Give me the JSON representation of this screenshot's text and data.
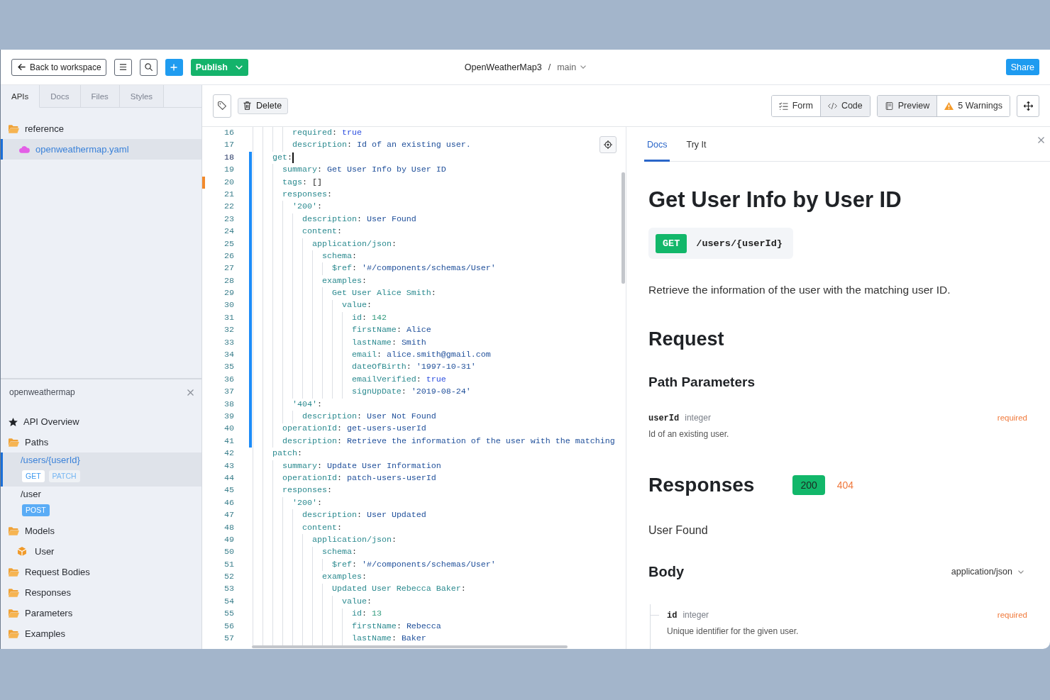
{
  "top_bar": {
    "back_button": "Back to workspace",
    "publish_button": "Publish",
    "project": "OpenWeatherMap3",
    "separator": "/",
    "branch": "main",
    "share_button": "Share"
  },
  "sidebar": {
    "tabs": [
      {
        "label": "APIs",
        "selected": true
      },
      {
        "label": "Docs",
        "selected": false
      },
      {
        "label": "Files",
        "selected": false
      },
      {
        "label": "Styles",
        "selected": false
      }
    ],
    "files": [
      {
        "label": "reference",
        "kind": "folder",
        "selected": false,
        "children": [
          {
            "label": "openweathermap.yaml",
            "kind": "api",
            "selected": true
          }
        ]
      }
    ],
    "outline": {
      "title": "openweathermap",
      "items": [
        {
          "label": "API Overview",
          "kind": "overview",
          "selected": false
        },
        {
          "label": "Paths",
          "kind": "folder",
          "selected": false,
          "children": [
            {
              "label": "/users/{userId}",
              "kind": "path",
              "selected": true,
              "methods": [
                {
                  "label": "GET",
                  "selected": true
                },
                {
                  "label": "PATCH",
                  "selected": false
                }
              ]
            },
            {
              "label": "/user",
              "kind": "path",
              "selected": false,
              "methods": [
                {
                  "label": "POST",
                  "selected": false
                }
              ]
            }
          ]
        },
        {
          "label": "Models",
          "kind": "folder",
          "selected": false,
          "children": [
            {
              "label": "User",
              "kind": "model",
              "selected": false
            }
          ]
        },
        {
          "label": "Request Bodies",
          "kind": "folder",
          "selected": false
        },
        {
          "label": "Responses",
          "kind": "folder",
          "selected": false
        },
        {
          "label": "Parameters",
          "kind": "folder",
          "selected": false
        },
        {
          "label": "Examples",
          "kind": "folder",
          "selected": false
        }
      ]
    }
  },
  "toolbar": {
    "delete_button": "Delete",
    "modes": [
      {
        "label": "Form",
        "selected": false
      },
      {
        "label": "Code",
        "selected": true
      }
    ],
    "preview_toggle": {
      "label": "Preview",
      "selected": true
    },
    "warnings_button": "5 Warnings"
  },
  "editor": {
    "lines": [
      {
        "number": "16",
        "active": false,
        "changed": false,
        "warning": false,
        "tokens": [
          {
            "kind": "key",
            "text": "        required"
          },
          {
            "kind": "punct",
            "text": ": "
          },
          {
            "kind": "boolean",
            "text": "true"
          }
        ]
      },
      {
        "number": "17",
        "active": false,
        "changed": false,
        "warning": false,
        "tokens": [
          {
            "kind": "key",
            "text": "        description"
          },
          {
            "kind": "punct",
            "text": ": "
          },
          {
            "kind": "string",
            "text": "Id of an existing user."
          }
        ]
      },
      {
        "number": "18",
        "active": true,
        "changed": true,
        "warning": false,
        "tokens": [
          {
            "kind": "key",
            "text": "    get"
          },
          {
            "kind": "punct",
            "text": ":"
          }
        ]
      },
      {
        "number": "19",
        "active": false,
        "changed": true,
        "warning": false,
        "tokens": [
          {
            "kind": "key",
            "text": "      summary"
          },
          {
            "kind": "punct",
            "text": ": "
          },
          {
            "kind": "string",
            "text": "Get User Info by User ID"
          }
        ]
      },
      {
        "number": "20",
        "active": false,
        "changed": true,
        "warning": true,
        "tokens": [
          {
            "kind": "key",
            "text": "      tags"
          },
          {
            "kind": "punct",
            "text": ": "
          },
          {
            "kind": "plain",
            "text": "[]"
          }
        ]
      },
      {
        "number": "21",
        "active": false,
        "changed": true,
        "warning": false,
        "tokens": [
          {
            "kind": "key",
            "text": "      responses"
          },
          {
            "kind": "punct",
            "text": ":"
          }
        ]
      },
      {
        "number": "22",
        "active": false,
        "changed": true,
        "warning": false,
        "tokens": [
          {
            "kind": "key",
            "text": "        '200'"
          },
          {
            "kind": "punct",
            "text": ":"
          }
        ]
      },
      {
        "number": "23",
        "active": false,
        "changed": true,
        "warning": false,
        "tokens": [
          {
            "kind": "key",
            "text": "          description"
          },
          {
            "kind": "punct",
            "text": ": "
          },
          {
            "kind": "string",
            "text": "User Found"
          }
        ]
      },
      {
        "number": "24",
        "active": false,
        "changed": true,
        "warning": false,
        "tokens": [
          {
            "kind": "key",
            "text": "          content"
          },
          {
            "kind": "punct",
            "text": ":"
          }
        ]
      },
      {
        "number": "25",
        "active": false,
        "changed": true,
        "warning": false,
        "tokens": [
          {
            "kind": "key",
            "text": "            application/json"
          },
          {
            "kind": "punct",
            "text": ":"
          }
        ]
      },
      {
        "number": "26",
        "active": false,
        "changed": true,
        "warning": false,
        "tokens": [
          {
            "kind": "key",
            "text": "              schema"
          },
          {
            "kind": "punct",
            "text": ":"
          }
        ]
      },
      {
        "number": "27",
        "active": false,
        "changed": true,
        "warning": false,
        "tokens": [
          {
            "kind": "key",
            "text": "                $ref"
          },
          {
            "kind": "punct",
            "text": ": "
          },
          {
            "kind": "string",
            "text": "'#/components/schemas/User'"
          }
        ]
      },
      {
        "number": "28",
        "active": false,
        "changed": true,
        "warning": false,
        "tokens": [
          {
            "kind": "key",
            "text": "              examples"
          },
          {
            "kind": "punct",
            "text": ":"
          }
        ]
      },
      {
        "number": "29",
        "active": false,
        "changed": true,
        "warning": false,
        "tokens": [
          {
            "kind": "key",
            "text": "                Get User Alice Smith"
          },
          {
            "kind": "punct",
            "text": ":"
          }
        ]
      },
      {
        "number": "30",
        "active": false,
        "changed": true,
        "warning": false,
        "tokens": [
          {
            "kind": "key",
            "text": "                  value"
          },
          {
            "kind": "punct",
            "text": ":"
          }
        ]
      },
      {
        "number": "31",
        "active": false,
        "changed": true,
        "warning": false,
        "tokens": [
          {
            "kind": "key",
            "text": "                    id"
          },
          {
            "kind": "punct",
            "text": ": "
          },
          {
            "kind": "number",
            "text": "142"
          }
        ]
      },
      {
        "number": "32",
        "active": false,
        "changed": true,
        "warning": false,
        "tokens": [
          {
            "kind": "key",
            "text": "                    firstName"
          },
          {
            "kind": "punct",
            "text": ": "
          },
          {
            "kind": "string",
            "text": "Alice"
          }
        ]
      },
      {
        "number": "33",
        "active": false,
        "changed": true,
        "warning": false,
        "tokens": [
          {
            "kind": "key",
            "text": "                    lastName"
          },
          {
            "kind": "punct",
            "text": ": "
          },
          {
            "kind": "string",
            "text": "Smith"
          }
        ]
      },
      {
        "number": "34",
        "active": false,
        "changed": true,
        "warning": false,
        "tokens": [
          {
            "kind": "key",
            "text": "                    email"
          },
          {
            "kind": "punct",
            "text": ": "
          },
          {
            "kind": "string",
            "text": "alice.smith@gmail.com"
          }
        ]
      },
      {
        "number": "35",
        "active": false,
        "changed": true,
        "warning": false,
        "tokens": [
          {
            "kind": "key",
            "text": "                    dateOfBirth"
          },
          {
            "kind": "punct",
            "text": ": "
          },
          {
            "kind": "string",
            "text": "'1997-10-31'"
          }
        ]
      },
      {
        "number": "36",
        "active": false,
        "changed": true,
        "warning": false,
        "tokens": [
          {
            "kind": "key",
            "text": "                    emailVerified"
          },
          {
            "kind": "punct",
            "text": ": "
          },
          {
            "kind": "boolean",
            "text": "true"
          }
        ]
      },
      {
        "number": "37",
        "active": false,
        "changed": true,
        "warning": false,
        "tokens": [
          {
            "kind": "key",
            "text": "                    signUpDate"
          },
          {
            "kind": "punct",
            "text": ": "
          },
          {
            "kind": "string",
            "text": "'2019-08-24'"
          }
        ]
      },
      {
        "number": "38",
        "active": false,
        "changed": true,
        "warning": false,
        "tokens": [
          {
            "kind": "key",
            "text": "        '404'"
          },
          {
            "kind": "punct",
            "text": ":"
          }
        ]
      },
      {
        "number": "39",
        "active": false,
        "changed": true,
        "warning": false,
        "tokens": [
          {
            "kind": "key",
            "text": "          description"
          },
          {
            "kind": "punct",
            "text": ": "
          },
          {
            "kind": "string",
            "text": "User Not Found"
          }
        ]
      },
      {
        "number": "40",
        "active": false,
        "changed": true,
        "warning": false,
        "tokens": [
          {
            "kind": "key",
            "text": "      operationId"
          },
          {
            "kind": "punct",
            "text": ": "
          },
          {
            "kind": "string",
            "text": "get-users-userId"
          }
        ]
      },
      {
        "number": "41",
        "active": false,
        "changed": true,
        "warning": false,
        "tokens": [
          {
            "kind": "key",
            "text": "      description"
          },
          {
            "kind": "punct",
            "text": ": "
          },
          {
            "kind": "string",
            "text": "Retrieve the information of the user with the matching"
          }
        ]
      },
      {
        "number": "42",
        "active": false,
        "changed": false,
        "warning": false,
        "tokens": [
          {
            "kind": "key",
            "text": "    patch"
          },
          {
            "kind": "punct",
            "text": ":"
          }
        ]
      },
      {
        "number": "43",
        "active": false,
        "changed": false,
        "warning": false,
        "tokens": [
          {
            "kind": "key",
            "text": "      summary"
          },
          {
            "kind": "punct",
            "text": ": "
          },
          {
            "kind": "string",
            "text": "Update User Information"
          }
        ]
      },
      {
        "number": "44",
        "active": false,
        "changed": false,
        "warning": false,
        "tokens": [
          {
            "kind": "key",
            "text": "      operationId"
          },
          {
            "kind": "punct",
            "text": ": "
          },
          {
            "kind": "string",
            "text": "patch-users-userId"
          }
        ]
      },
      {
        "number": "45",
        "active": false,
        "changed": false,
        "warning": false,
        "tokens": [
          {
            "kind": "key",
            "text": "      responses"
          },
          {
            "kind": "punct",
            "text": ":"
          }
        ]
      },
      {
        "number": "46",
        "active": false,
        "changed": false,
        "warning": false,
        "tokens": [
          {
            "kind": "key",
            "text": "        '200'"
          },
          {
            "kind": "punct",
            "text": ":"
          }
        ]
      },
      {
        "number": "47",
        "active": false,
        "changed": false,
        "warning": false,
        "tokens": [
          {
            "kind": "key",
            "text": "          description"
          },
          {
            "kind": "punct",
            "text": ": "
          },
          {
            "kind": "string",
            "text": "User Updated"
          }
        ]
      },
      {
        "number": "48",
        "active": false,
        "changed": false,
        "warning": false,
        "tokens": [
          {
            "kind": "key",
            "text": "          content"
          },
          {
            "kind": "punct",
            "text": ":"
          }
        ]
      },
      {
        "number": "49",
        "active": false,
        "changed": false,
        "warning": false,
        "tokens": [
          {
            "kind": "key",
            "text": "            application/json"
          },
          {
            "kind": "punct",
            "text": ":"
          }
        ]
      },
      {
        "number": "50",
        "active": false,
        "changed": false,
        "warning": false,
        "tokens": [
          {
            "kind": "key",
            "text": "              schema"
          },
          {
            "kind": "punct",
            "text": ":"
          }
        ]
      },
      {
        "number": "51",
        "active": false,
        "changed": false,
        "warning": false,
        "tokens": [
          {
            "kind": "key",
            "text": "                $ref"
          },
          {
            "kind": "punct",
            "text": ": "
          },
          {
            "kind": "string",
            "text": "'#/components/schemas/User'"
          }
        ]
      },
      {
        "number": "52",
        "active": false,
        "changed": false,
        "warning": false,
        "tokens": [
          {
            "kind": "key",
            "text": "              examples"
          },
          {
            "kind": "punct",
            "text": ":"
          }
        ]
      },
      {
        "number": "53",
        "active": false,
        "changed": false,
        "warning": false,
        "tokens": [
          {
            "kind": "key",
            "text": "                Updated User Rebecca Baker"
          },
          {
            "kind": "punct",
            "text": ":"
          }
        ]
      },
      {
        "number": "54",
        "active": false,
        "changed": false,
        "warning": false,
        "tokens": [
          {
            "kind": "key",
            "text": "                  value"
          },
          {
            "kind": "punct",
            "text": ":"
          }
        ]
      },
      {
        "number": "55",
        "active": false,
        "changed": false,
        "warning": false,
        "tokens": [
          {
            "kind": "key",
            "text": "                    id"
          },
          {
            "kind": "punct",
            "text": ": "
          },
          {
            "kind": "number",
            "text": "13"
          }
        ]
      },
      {
        "number": "56",
        "active": false,
        "changed": false,
        "warning": false,
        "tokens": [
          {
            "kind": "key",
            "text": "                    firstName"
          },
          {
            "kind": "punct",
            "text": ": "
          },
          {
            "kind": "string",
            "text": "Rebecca"
          }
        ]
      },
      {
        "number": "57",
        "active": false,
        "changed": false,
        "warning": false,
        "tokens": [
          {
            "kind": "key",
            "text": "                    lastName"
          },
          {
            "kind": "punct",
            "text": ": "
          },
          {
            "kind": "string",
            "text": "Baker"
          }
        ]
      }
    ]
  },
  "preview": {
    "tabs": [
      {
        "label": "Docs",
        "selected": true
      },
      {
        "label": "Try It",
        "selected": false
      }
    ],
    "title": "Get User Info by User ID",
    "method": "GET",
    "path": "/users/{userId}",
    "description": "Retrieve the information of the user with the matching user ID.",
    "request_heading": "Request",
    "path_parameters_heading": "Path Parameters",
    "path_parameters": [
      {
        "name": "userId",
        "type": "integer",
        "required": "required",
        "description": "Id of an existing user."
      }
    ],
    "responses_heading": "Responses",
    "response_codes": [
      {
        "label": "200",
        "selected": true,
        "color": "#12b76a"
      },
      {
        "label": "404",
        "selected": false,
        "color": "#f0783c"
      }
    ],
    "response_description": "User Found",
    "body_heading": "Body",
    "media_type": "application/json",
    "body_fields": [
      {
        "name": "id",
        "type": "integer",
        "required": "required",
        "description": "Unique identifier for the given user."
      }
    ]
  }
}
